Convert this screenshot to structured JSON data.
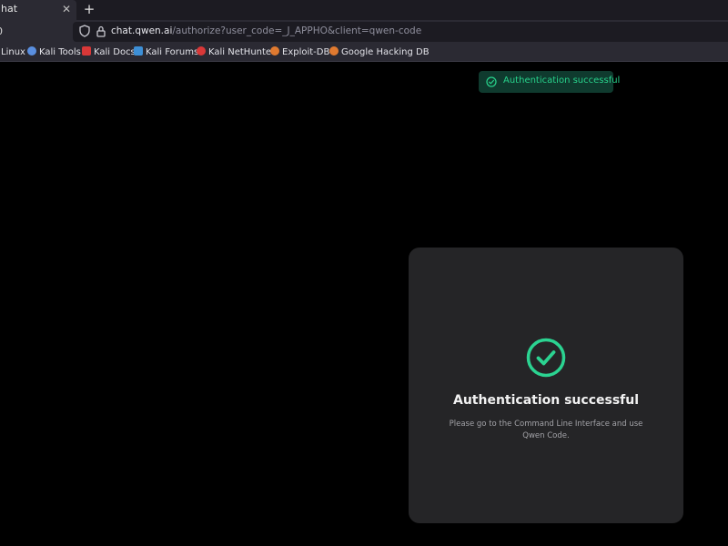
{
  "browser": {
    "tab": {
      "title": "hat",
      "close_icon": "close-icon"
    },
    "new_tab_label": "+",
    "nav_edge_label": "0",
    "url": {
      "host": "chat.qwen.ai",
      "path": "/authorize?user_code=_J_APPHO&client=qwen-code"
    },
    "bookmarks": [
      {
        "label": "Linux",
        "icon": "none"
      },
      {
        "label": "Kali Tools",
        "icon": "kali-tools-icon",
        "color": "#5a8fe0"
      },
      {
        "label": "Kali Docs",
        "icon": "kali-docs-icon",
        "color": "#d93838"
      },
      {
        "label": "Kali Forums",
        "icon": "kali-forums-icon",
        "color": "#3d8fd6"
      },
      {
        "label": "Kali NetHunter",
        "icon": "kali-nethunter-icon",
        "color": "#d93838"
      },
      {
        "label": "Exploit-DB",
        "icon": "exploit-db-icon",
        "color": "#e07a30"
      },
      {
        "label": "Google Hacking DB",
        "icon": "google-hacking-db-icon",
        "color": "#e07a30"
      }
    ]
  },
  "toast": {
    "text": "Authentication successful",
    "icon": "check-circle-icon",
    "color": "#28d38c"
  },
  "card": {
    "title": "Authentication successful",
    "description": "Please go to the Command Line Interface and use Qwen Code.",
    "icon": "check-circle-icon",
    "accent_color": "#2bd391"
  }
}
